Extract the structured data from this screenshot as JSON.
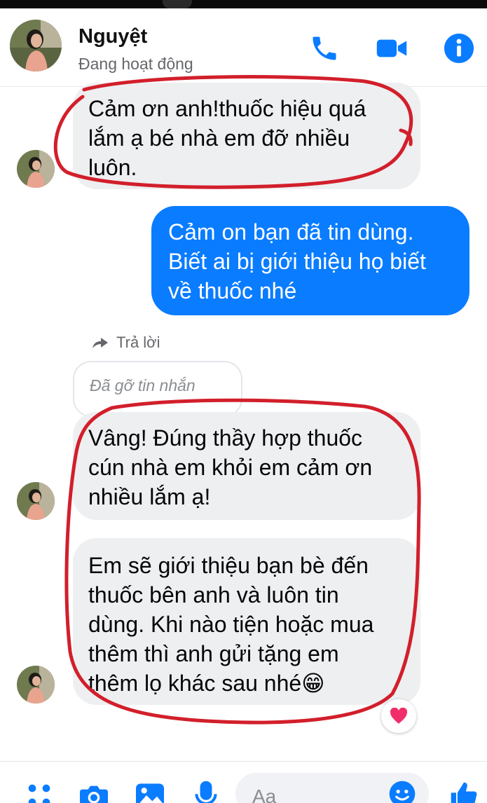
{
  "header": {
    "contact_name": "Nguyệt",
    "status": "Đang hoạt động",
    "icons": [
      "phone-icon",
      "video-icon",
      "info-icon"
    ]
  },
  "messages": {
    "m1": {
      "line1": "Cảm ơn anh!thuốc hiệu quá",
      "line2": "lắm ạ bé nhà em đỡ nhiều",
      "line3": "luôn."
    },
    "m2": {
      "line1": "Cảm on bạn đã tin dùng.",
      "line2": "Biết ai bị giới thiệu họ biết",
      "line3": "về thuốc nhé"
    },
    "reply_label": "Trả lời",
    "removed_label": "Đã gỡ tin nhắn",
    "m3": {
      "line1": "Vâng! Đúng thầy hợp thuốc",
      "line2": "cún nhà em khỏi em cảm ơn",
      "line3": "nhiều lắm ạ!"
    },
    "m4": {
      "line1": "Em sẽ giới thiệu bạn bè đến",
      "line2": "thuốc bên anh và luôn tin",
      "line3": "dùng. Khi nào tiện hoặc mua",
      "line4": "thêm thì anh gửi tặng em",
      "line5": "thêm lọ khác sau nhé😁"
    },
    "reaction": "heart-icon"
  },
  "composer": {
    "placeholder": "Aa",
    "icons": [
      "apps-icon",
      "camera-icon",
      "image-icon",
      "microphone-icon",
      "emoji-icon",
      "thumbs-up-icon"
    ]
  },
  "colors": {
    "accent": "#0a7cff",
    "incoming_bubble": "#eeeff1",
    "annotation_ring": "#d21f2b"
  }
}
